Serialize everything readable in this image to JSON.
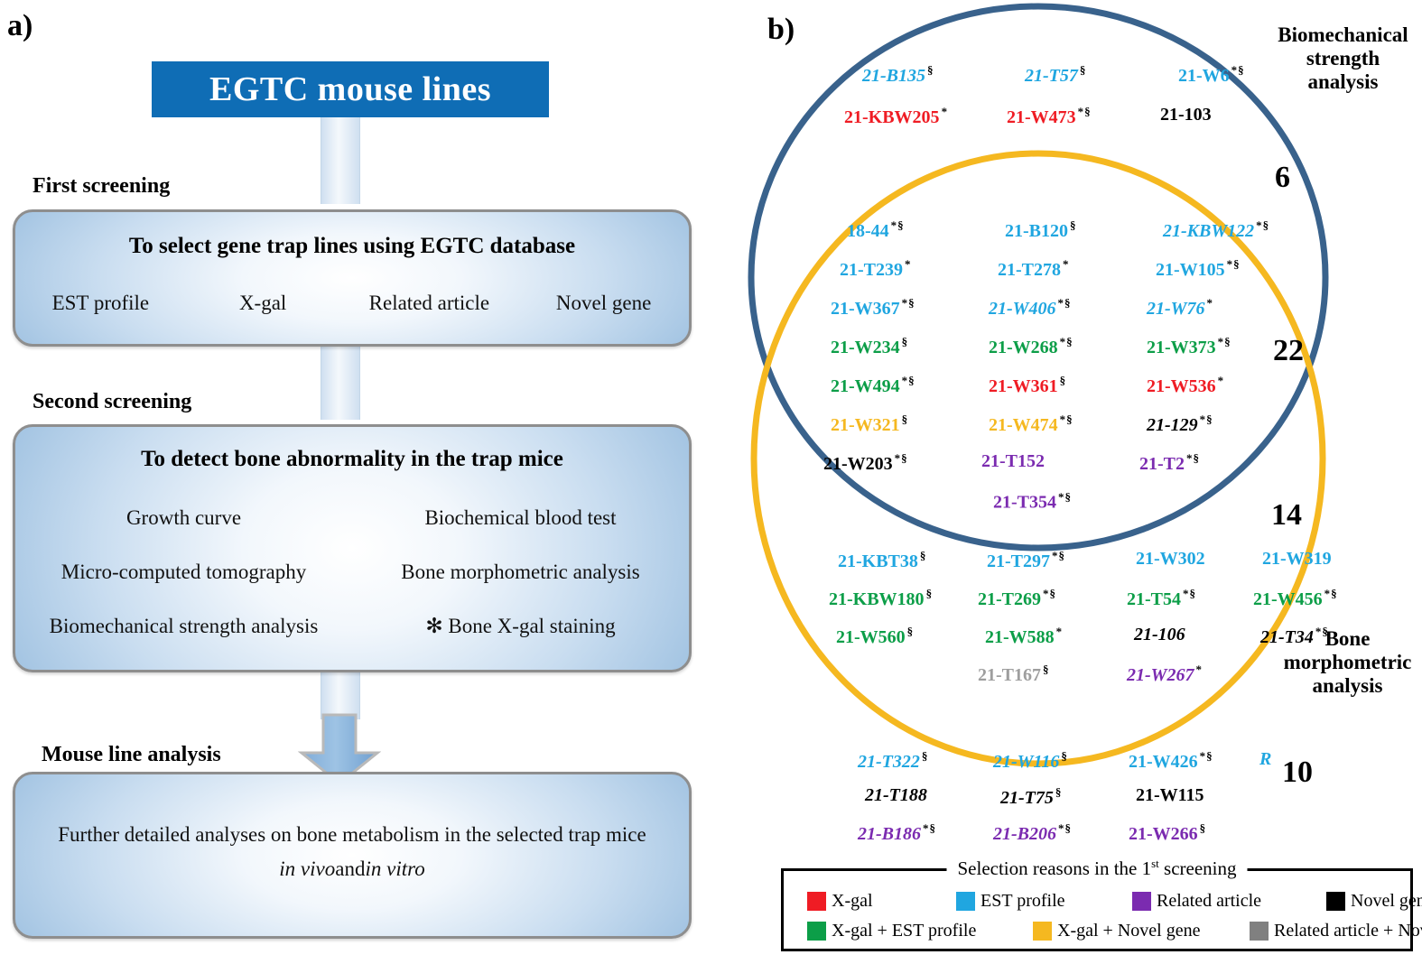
{
  "panel_a": {
    "tag": "a)",
    "header": "EGTC mouse lines",
    "header_color": "#0f6db5",
    "stages": [
      {
        "label": "First screening"
      },
      {
        "label": "Second screening"
      },
      {
        "label": "Mouse line analysis"
      }
    ],
    "box_first": {
      "title": "To select gene trap lines using EGTC database",
      "items": [
        "EST profile",
        "X-gal",
        "Related article",
        "Novel gene"
      ]
    },
    "box_second": {
      "title": "To detect bone abnormality in the trap mice",
      "rows": [
        [
          "Growth curve",
          "Biochemical blood test"
        ],
        [
          "Micro-computed tomography",
          "Bone morphometric analysis"
        ],
        [
          "Biomechanical strength analysis",
          "✻ Bone X-gal staining"
        ]
      ]
    },
    "box_final": {
      "line1": "Further detailed analyses on bone metabolism in the selected trap mice",
      "line2_italic_a": "in vivo",
      "line2_plain": " and ",
      "line2_italic_b": "in vitro"
    }
  },
  "panel_b": {
    "tag": "b)",
    "circle_blue_label": "Biomechanical\nstrength\nanalysis",
    "circle_yellow_label": "Bone\nmorphometric\nanalysis",
    "circle_blue_color": "#39628c",
    "circle_yellow_color": "#f5b820",
    "counts": {
      "blue_only": "6",
      "intersection": "22",
      "yellow_only": "14",
      "outside": "10"
    },
    "regions": {
      "blue_only": [
        [
          {
            "name": "21-B135",
            "mark": "§",
            "color": "#20a6e0",
            "italic": true
          },
          {
            "name": "21-T57",
            "mark": "§",
            "color": "#20a6e0",
            "italic": true
          },
          {
            "name": "21-W6",
            "mark": "*§",
            "color": "#20a6e0",
            "italic": false
          }
        ],
        [
          {
            "name": "21-KBW205",
            "mark": "*",
            "color": "#ef1c24",
            "italic": false
          },
          {
            "name": "21-W473",
            "mark": "*§",
            "color": "#ef1c24",
            "italic": false
          },
          {
            "name": "21-103",
            "mark": "",
            "color": "#000000",
            "italic": false
          }
        ]
      ],
      "intersection": [
        [
          {
            "name": "18-44",
            "mark": "*§",
            "color": "#20a6e0",
            "italic": false
          },
          {
            "name": "21-B120",
            "mark": "§",
            "color": "#20a6e0",
            "italic": false
          },
          {
            "name": "21-KBW122",
            "mark": "*§",
            "color": "#20a6e0",
            "italic": true
          }
        ],
        [
          {
            "name": "21-T239",
            "mark": "*",
            "color": "#20a6e0",
            "italic": false
          },
          {
            "name": "21-T278",
            "mark": "*",
            "color": "#20a6e0",
            "italic": false
          },
          {
            "name": "21-W105",
            "mark": "*§",
            "color": "#20a6e0",
            "italic": false
          }
        ],
        [
          {
            "name": "21-W367",
            "mark": "*§",
            "color": "#20a6e0",
            "italic": false
          },
          {
            "name": "21-W406",
            "mark": "*§",
            "color": "#20a6e0",
            "italic": true
          },
          {
            "name": "21-W76",
            "mark": "*",
            "color": "#20a6e0",
            "italic": true
          }
        ],
        [
          {
            "name": "21-W234",
            "mark": "§",
            "color": "#0c9e48",
            "italic": false
          },
          {
            "name": "21-W268",
            "mark": "*§",
            "color": "#0c9e48",
            "italic": false
          },
          {
            "name": "21-W373",
            "mark": "*§",
            "color": "#0c9e48",
            "italic": false
          }
        ],
        [
          {
            "name": "21-W494",
            "mark": "*§",
            "color": "#0c9e48",
            "italic": false
          },
          {
            "name": "21-W361",
            "mark": "§",
            "color": "#ef1c24",
            "italic": false
          },
          {
            "name": "21-W536",
            "mark": "*",
            "color": "#ef1c24",
            "italic": false
          }
        ],
        [
          {
            "name": "21-W321",
            "mark": "§",
            "color": "#f5b820",
            "italic": false
          },
          {
            "name": "21-W474",
            "mark": "*§",
            "color": "#f5b820",
            "italic": false
          },
          {
            "name": "21-129",
            "mark": "*§",
            "color": "#000000",
            "italic": true
          }
        ],
        [
          {
            "name": "21-W203",
            "mark": "*§",
            "color": "#000000",
            "italic": false
          },
          {
            "name": "21-T152",
            "mark": "",
            "color": "#7b2bb0",
            "italic": false
          },
          {
            "name": "21-T2",
            "mark": "*§",
            "color": "#7b2bb0",
            "italic": false
          }
        ]
      ],
      "intersection_last": {
        "name": "21-T354",
        "mark": "*§",
        "color": "#7b2bb0",
        "italic": false
      },
      "yellow_only": [
        [
          {
            "name": "21-KBT38",
            "mark": "§",
            "color": "#20a6e0",
            "italic": false
          },
          {
            "name": "21-T297",
            "mark": "*§",
            "color": "#20a6e0",
            "italic": false
          },
          {
            "name": "21-W302",
            "mark": "",
            "color": "#20a6e0",
            "italic": false
          },
          {
            "name": "21-W319",
            "mark": "",
            "color": "#20a6e0",
            "italic": false
          }
        ],
        [
          {
            "name": "21-KBW180",
            "mark": "§",
            "color": "#0c9e48",
            "italic": false
          },
          {
            "name": "21-T269",
            "mark": "*§",
            "color": "#0c9e48",
            "italic": false
          },
          {
            "name": "21-T54",
            "mark": "*§",
            "color": "#0c9e48",
            "italic": false
          },
          {
            "name": "21-W456",
            "mark": "*§",
            "color": "#0c9e48",
            "italic": false
          }
        ],
        [
          {
            "name": "21-W560",
            "mark": "§",
            "color": "#0c9e48",
            "italic": false
          },
          {
            "name": "21-W588",
            "mark": "*",
            "color": "#0c9e48",
            "italic": false
          },
          {
            "name": "21-106",
            "mark": "",
            "color": "#000000",
            "italic": true
          },
          {
            "name": "21-T34",
            "mark": "*§",
            "color": "#000000",
            "italic": true
          }
        ],
        [
          {
            "name": "",
            "mark": "",
            "color": "#000000",
            "italic": false
          },
          {
            "name": "21-T167",
            "mark": "§",
            "color": "#9e9e9e",
            "italic": false
          },
          {
            "name": "21-W267",
            "mark": "*",
            "color": "#7b2bb0",
            "italic": true
          },
          {
            "name": "",
            "mark": "",
            "color": "#000000",
            "italic": false
          }
        ]
      ],
      "outside": [
        [
          {
            "name": "21-T322",
            "mark": "§",
            "color": "#20a6e0",
            "italic": true
          },
          {
            "name": "21-W116",
            "mark": "§",
            "color": "#20a6e0",
            "italic": true
          },
          {
            "name": "21-W426",
            "mark": "*§",
            "color": "#20a6e0",
            "italic": false
          },
          {
            "name": "R",
            "mark": "",
            "color": "#20a6e0",
            "italic": true
          }
        ],
        [
          {
            "name": "21-T188",
            "mark": "",
            "color": "#000000",
            "italic": true
          },
          {
            "name": "21-T75",
            "mark": "§",
            "color": "#000000",
            "italic": true
          },
          {
            "name": "21-W115",
            "mark": "",
            "color": "#000000",
            "italic": false
          },
          {
            "name": "",
            "mark": "",
            "color": "#000000",
            "italic": false
          }
        ],
        [
          {
            "name": "21-B186",
            "mark": "*§",
            "color": "#7b2bb0",
            "italic": true
          },
          {
            "name": "21-B206",
            "mark": "*§",
            "color": "#7b2bb0",
            "italic": true
          },
          {
            "name": "21-W266",
            "mark": "§",
            "color": "#7b2bb0",
            "italic": false
          },
          {
            "name": "",
            "mark": "",
            "color": "#000000",
            "italic": false
          }
        ]
      ]
    },
    "legend": {
      "title_main": "Selection reasons in the 1",
      "title_sup": "st",
      "title_tail": " screening",
      "row1": [
        {
          "label": "X-gal",
          "color": "#ef1c24"
        },
        {
          "label": "EST profile",
          "color": "#20a6e0"
        },
        {
          "label": "Related article",
          "color": "#7b2bb0"
        },
        {
          "label": "Novel gene",
          "color": "#000000"
        }
      ],
      "row2": [
        {
          "label": "X-gal + EST profile",
          "color": "#0c9e48"
        },
        {
          "label": "X-gal + Novel gene",
          "color": "#f5b820"
        },
        {
          "label": "Related article + Novel gene",
          "color": "#808080"
        }
      ]
    }
  }
}
